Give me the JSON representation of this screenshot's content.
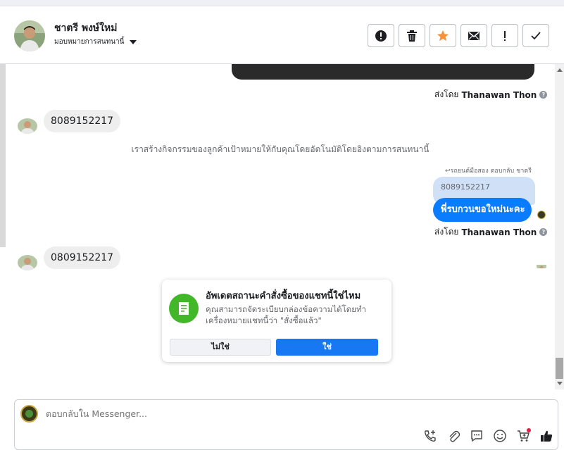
{
  "header": {
    "contact_name": "ชาตรี พงษ์ใหม่",
    "assign_label": "มอบหมายการสนทนานี้",
    "actions": [
      {
        "name": "mark-spam-button",
        "icon": "exclamation-circle-icon"
      },
      {
        "name": "delete-button",
        "icon": "trash-icon"
      },
      {
        "name": "star-button",
        "icon": "star-icon"
      },
      {
        "name": "mark-unread-button",
        "icon": "envelope-icon"
      },
      {
        "name": "follow-up-button",
        "icon": "exclamation-icon"
      },
      {
        "name": "mark-done-button",
        "icon": "check-icon"
      }
    ]
  },
  "messages": {
    "sent_by_prefix": "ส่งโดย",
    "sent_by_name": "Thanawan Thon",
    "incoming_1": "8089152217",
    "system_note": "เราสร้างกิจกรรมของลูกค้าเป้าหมายให้กับคุณโดยอัตโนมัติโดยอิงตามการสนทนานี้",
    "reply_meta": "↩รถยนต์มือสอง ตอบกลับ ชาตรี",
    "quoted_text": "8089152217",
    "outgoing_1": "พี่รบกวนขอใหม่นะคะ",
    "incoming_2": "0809152217"
  },
  "popup": {
    "title": "อัพเดตสถานะคำสั่งซื้อของแชทนี้ใช่ไหม",
    "description": "คุณสามารถจัดระเบียบกล่องข้อความได้โดยทำเครื่องหมายแชทนี้ว่า \"สั่งซื้อแล้ว\"",
    "no_label": "ไม่ใช่",
    "yes_label": "ใช่"
  },
  "composer": {
    "placeholder": "ตอบกลับใน Messenger...",
    "tools": [
      "add-call-icon",
      "attachment-icon",
      "saved-reply-icon",
      "emoji-icon",
      "cart-icon",
      "like-icon"
    ]
  },
  "colors": {
    "accent": "#1877f2",
    "outgoing_bubble": "#0a7cff",
    "incoming_bubble": "#eeeeee",
    "quoted_bubble": "#cfe0f7",
    "popup_icon": "#42b72a",
    "star": "#f7923b"
  }
}
